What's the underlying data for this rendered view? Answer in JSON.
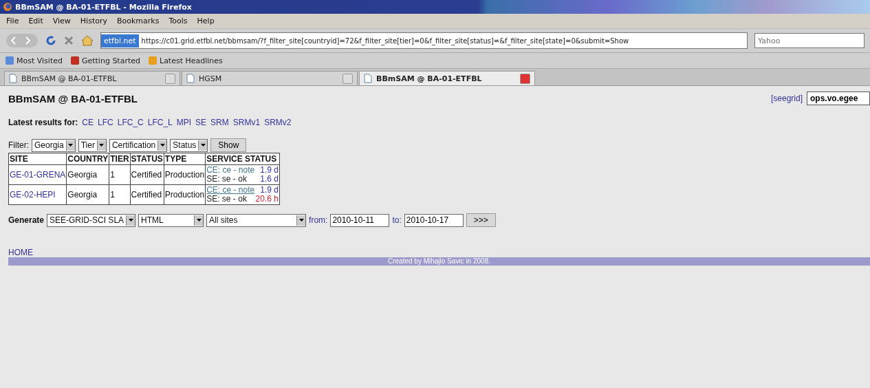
{
  "window": {
    "title": "BBmSAM @ BA-01-ETFBL - Mozilla Firefox"
  },
  "menu": [
    "File",
    "Edit",
    "View",
    "History",
    "Bookmarks",
    "Tools",
    "Help"
  ],
  "address": {
    "site": "etfbl.net",
    "url": "https://c01.grid.etfbl.net/bbmsam/?f_filter_site[countryid]=72&f_filter_site[tier]=0&f_filter_site[status]=&f_filter_site[state]=0&submit=Show"
  },
  "search": {
    "placeholder": "Yahoo"
  },
  "bookmarks": [
    "Most Visited",
    "Getting Started",
    "Latest Headlines"
  ],
  "tabs": [
    {
      "label": "BBmSAM @ BA-01-ETFBL",
      "selected": false
    },
    {
      "label": "HGSM",
      "selected": false
    },
    {
      "label": "BBmSAM @ BA-01-ETFBL",
      "selected": true
    }
  ],
  "page": {
    "title": "BBmSAM @ BA-01-ETFBL",
    "grid_link": "[seegrid]",
    "vo_field": "ops.vo.egee",
    "latest_label": "Latest results for:",
    "latest_links": [
      "CE",
      "LFC",
      "LFC_C",
      "LFC_L",
      "MPI",
      "SE",
      "SRM",
      "SRMv1",
      "SRMv2"
    ],
    "filter": {
      "label": "Filter:",
      "selects": [
        "Georgia",
        "Tier",
        "Certification",
        "Status"
      ],
      "button": "Show"
    },
    "table": {
      "columns": [
        "SITE",
        "COUNTRY",
        "TIER",
        "STATUS",
        "TYPE",
        "SERVICE STATUS"
      ],
      "rows": [
        {
          "site": "GE-01-GRENA",
          "country": "Georgia",
          "tier": "1",
          "status": "Certified",
          "type": "Production",
          "services": [
            {
              "label": "CE: ce - note",
              "kind": "note",
              "linked": false,
              "age": "1.9 d",
              "color": "#3333aa"
            },
            {
              "label": "SE: se - ok",
              "kind": "ok",
              "linked": false,
              "age": "1.6 d",
              "color": "#3333aa"
            }
          ]
        },
        {
          "site": "GE-02-HEPI",
          "country": "Georgia",
          "tier": "1",
          "status": "Certified",
          "type": "Production",
          "services": [
            {
              "label": "CE: ce - note",
              "kind": "note",
              "linked": true,
              "age": "1.9 d",
              "color": "#3333aa"
            },
            {
              "label": "SE: se - ok",
              "kind": "ok",
              "linked": false,
              "age": "20.6 h",
              "color": "#cc2233"
            }
          ]
        }
      ]
    },
    "generate": {
      "label": "Generate",
      "selects": [
        "SEE-GRID-SCI SLA",
        "HTML",
        "All sites"
      ],
      "from_label": "from:",
      "from": "2010-10-11",
      "to_label": "to:",
      "to": "2010-10-17",
      "button": ">>>"
    },
    "home": "HOME",
    "footer": "Created by Mihajlo Savic in 2008."
  }
}
